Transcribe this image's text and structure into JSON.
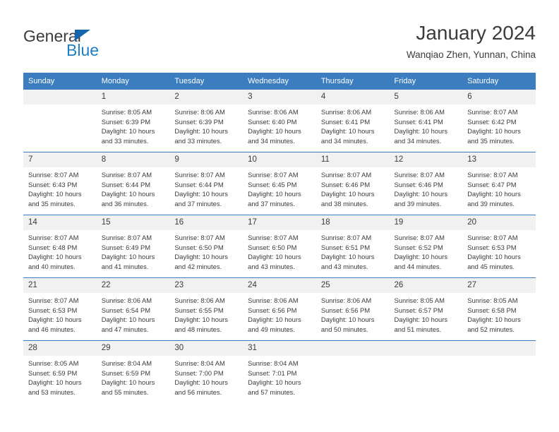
{
  "branding": {
    "name_part1": "General",
    "name_part2": "Blue",
    "triangle_color": "#1565ac",
    "blue_text_color": "#1f7fc4"
  },
  "header": {
    "title": "January 2024",
    "subtitle": "Wanqiao Zhen, Yunnan, China"
  },
  "theme": {
    "header_bar_color": "#3b7dbf",
    "daynum_band_color": "#f1f1f1",
    "text_color": "#3b3b3b"
  },
  "calendar": {
    "weekday_headers": [
      "Sunday",
      "Monday",
      "Tuesday",
      "Wednesday",
      "Thursday",
      "Friday",
      "Saturday"
    ],
    "weeks": [
      [
        {
          "day": "",
          "lines": []
        },
        {
          "day": "1",
          "lines": [
            "Sunrise: 8:05 AM",
            "Sunset: 6:39 PM",
            "Daylight: 10 hours",
            "and 33 minutes."
          ]
        },
        {
          "day": "2",
          "lines": [
            "Sunrise: 8:06 AM",
            "Sunset: 6:39 PM",
            "Daylight: 10 hours",
            "and 33 minutes."
          ]
        },
        {
          "day": "3",
          "lines": [
            "Sunrise: 8:06 AM",
            "Sunset: 6:40 PM",
            "Daylight: 10 hours",
            "and 34 minutes."
          ]
        },
        {
          "day": "4",
          "lines": [
            "Sunrise: 8:06 AM",
            "Sunset: 6:41 PM",
            "Daylight: 10 hours",
            "and 34 minutes."
          ]
        },
        {
          "day": "5",
          "lines": [
            "Sunrise: 8:06 AM",
            "Sunset: 6:41 PM",
            "Daylight: 10 hours",
            "and 34 minutes."
          ]
        },
        {
          "day": "6",
          "lines": [
            "Sunrise: 8:07 AM",
            "Sunset: 6:42 PM",
            "Daylight: 10 hours",
            "and 35 minutes."
          ]
        }
      ],
      [
        {
          "day": "7",
          "lines": [
            "Sunrise: 8:07 AM",
            "Sunset: 6:43 PM",
            "Daylight: 10 hours",
            "and 35 minutes."
          ]
        },
        {
          "day": "8",
          "lines": [
            "Sunrise: 8:07 AM",
            "Sunset: 6:44 PM",
            "Daylight: 10 hours",
            "and 36 minutes."
          ]
        },
        {
          "day": "9",
          "lines": [
            "Sunrise: 8:07 AM",
            "Sunset: 6:44 PM",
            "Daylight: 10 hours",
            "and 37 minutes."
          ]
        },
        {
          "day": "10",
          "lines": [
            "Sunrise: 8:07 AM",
            "Sunset: 6:45 PM",
            "Daylight: 10 hours",
            "and 37 minutes."
          ]
        },
        {
          "day": "11",
          "lines": [
            "Sunrise: 8:07 AM",
            "Sunset: 6:46 PM",
            "Daylight: 10 hours",
            "and 38 minutes."
          ]
        },
        {
          "day": "12",
          "lines": [
            "Sunrise: 8:07 AM",
            "Sunset: 6:46 PM",
            "Daylight: 10 hours",
            "and 39 minutes."
          ]
        },
        {
          "day": "13",
          "lines": [
            "Sunrise: 8:07 AM",
            "Sunset: 6:47 PM",
            "Daylight: 10 hours",
            "and 39 minutes."
          ]
        }
      ],
      [
        {
          "day": "14",
          "lines": [
            "Sunrise: 8:07 AM",
            "Sunset: 6:48 PM",
            "Daylight: 10 hours",
            "and 40 minutes."
          ]
        },
        {
          "day": "15",
          "lines": [
            "Sunrise: 8:07 AM",
            "Sunset: 6:49 PM",
            "Daylight: 10 hours",
            "and 41 minutes."
          ]
        },
        {
          "day": "16",
          "lines": [
            "Sunrise: 8:07 AM",
            "Sunset: 6:50 PM",
            "Daylight: 10 hours",
            "and 42 minutes."
          ]
        },
        {
          "day": "17",
          "lines": [
            "Sunrise: 8:07 AM",
            "Sunset: 6:50 PM",
            "Daylight: 10 hours",
            "and 43 minutes."
          ]
        },
        {
          "day": "18",
          "lines": [
            "Sunrise: 8:07 AM",
            "Sunset: 6:51 PM",
            "Daylight: 10 hours",
            "and 43 minutes."
          ]
        },
        {
          "day": "19",
          "lines": [
            "Sunrise: 8:07 AM",
            "Sunset: 6:52 PM",
            "Daylight: 10 hours",
            "and 44 minutes."
          ]
        },
        {
          "day": "20",
          "lines": [
            "Sunrise: 8:07 AM",
            "Sunset: 6:53 PM",
            "Daylight: 10 hours",
            "and 45 minutes."
          ]
        }
      ],
      [
        {
          "day": "21",
          "lines": [
            "Sunrise: 8:07 AM",
            "Sunset: 6:53 PM",
            "Daylight: 10 hours",
            "and 46 minutes."
          ]
        },
        {
          "day": "22",
          "lines": [
            "Sunrise: 8:06 AM",
            "Sunset: 6:54 PM",
            "Daylight: 10 hours",
            "and 47 minutes."
          ]
        },
        {
          "day": "23",
          "lines": [
            "Sunrise: 8:06 AM",
            "Sunset: 6:55 PM",
            "Daylight: 10 hours",
            "and 48 minutes."
          ]
        },
        {
          "day": "24",
          "lines": [
            "Sunrise: 8:06 AM",
            "Sunset: 6:56 PM",
            "Daylight: 10 hours",
            "and 49 minutes."
          ]
        },
        {
          "day": "25",
          "lines": [
            "Sunrise: 8:06 AM",
            "Sunset: 6:56 PM",
            "Daylight: 10 hours",
            "and 50 minutes."
          ]
        },
        {
          "day": "26",
          "lines": [
            "Sunrise: 8:05 AM",
            "Sunset: 6:57 PM",
            "Daylight: 10 hours",
            "and 51 minutes."
          ]
        },
        {
          "day": "27",
          "lines": [
            "Sunrise: 8:05 AM",
            "Sunset: 6:58 PM",
            "Daylight: 10 hours",
            "and 52 minutes."
          ]
        }
      ],
      [
        {
          "day": "28",
          "lines": [
            "Sunrise: 8:05 AM",
            "Sunset: 6:59 PM",
            "Daylight: 10 hours",
            "and 53 minutes."
          ]
        },
        {
          "day": "29",
          "lines": [
            "Sunrise: 8:04 AM",
            "Sunset: 6:59 PM",
            "Daylight: 10 hours",
            "and 55 minutes."
          ]
        },
        {
          "day": "30",
          "lines": [
            "Sunrise: 8:04 AM",
            "Sunset: 7:00 PM",
            "Daylight: 10 hours",
            "and 56 minutes."
          ]
        },
        {
          "day": "31",
          "lines": [
            "Sunrise: 8:04 AM",
            "Sunset: 7:01 PM",
            "Daylight: 10 hours",
            "and 57 minutes."
          ]
        },
        {
          "day": "",
          "lines": []
        },
        {
          "day": "",
          "lines": []
        },
        {
          "day": "",
          "lines": []
        }
      ]
    ]
  }
}
